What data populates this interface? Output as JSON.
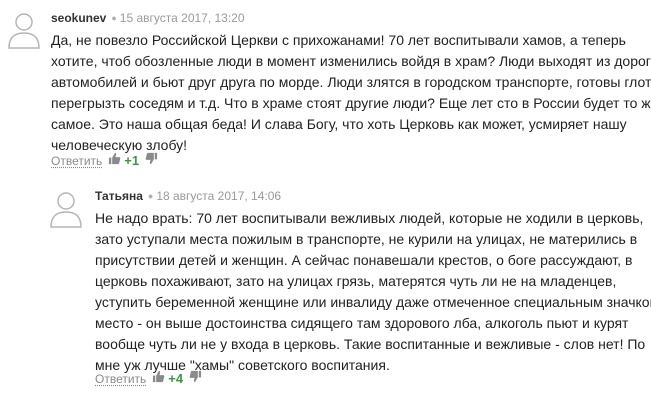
{
  "comments": [
    {
      "author": "seokunev",
      "date": "15 августа 2017, 13:20",
      "lines": [
        "Да, не повезло Российской Церкви с прихожанами! 70 лет воспитывали хамов, а теперь",
        "хотите, чтоб обозленные люди в момент изменились войдя в храм? Люди выходят из дорогих",
        "автомобилей и бьют друг друга по морде. Люди злятся в городском транспорте, готовы глотку",
        "перегрызть соседям и т.д. Что в храме стоят другие люди? Еще лет сто в России будет то же",
        "самое. Это наша общая беда! И слава Богу, что хоть Церковь как может, усмиряет нашу",
        "человеческую злобу!"
      ],
      "reply_label": "Ответить",
      "score": "+1",
      "icons": {
        "avatar": "user-avatar-icon",
        "up": "thumbs-up-icon",
        "down": "thumbs-down-icon"
      }
    },
    {
      "author": "Татьяна",
      "date": "18 августа 2017, 14:06",
      "lines": [
        "Не надо врать: 70 лет воспитывали вежливых людей, которые не ходили в церковь,",
        "зато уступали места пожилым в транспорте, не курили на улицах, не матерились в",
        "присутствии детей и женщин. А сейчас понавешали крестов, о боге рассуждают, в",
        "церковь похаживают, зато на улицах грязь, матерятся чуть ли не на младенцев,",
        "уступить беременной женщине или инвалиду даже отмеченное специальным значком",
        "место - он выше достоинства сидящего там здорового лба, алкоголь пьют и курят",
        "вообще чуть ли не у входа в церковь. Такие воспитанные и вежливые - слов нет! По",
        "мне уж лучше \"хамы\" советского воспитания."
      ],
      "reply_label": "Ответить",
      "score": "+4",
      "icons": {
        "avatar": "user-avatar-icon",
        "up": "thumbs-up-icon",
        "down": "thumbs-down-icon"
      }
    }
  ],
  "colors": {
    "score_positive": "#3a9a3a",
    "meta": "#9a9a9a",
    "text": "#222222"
  }
}
